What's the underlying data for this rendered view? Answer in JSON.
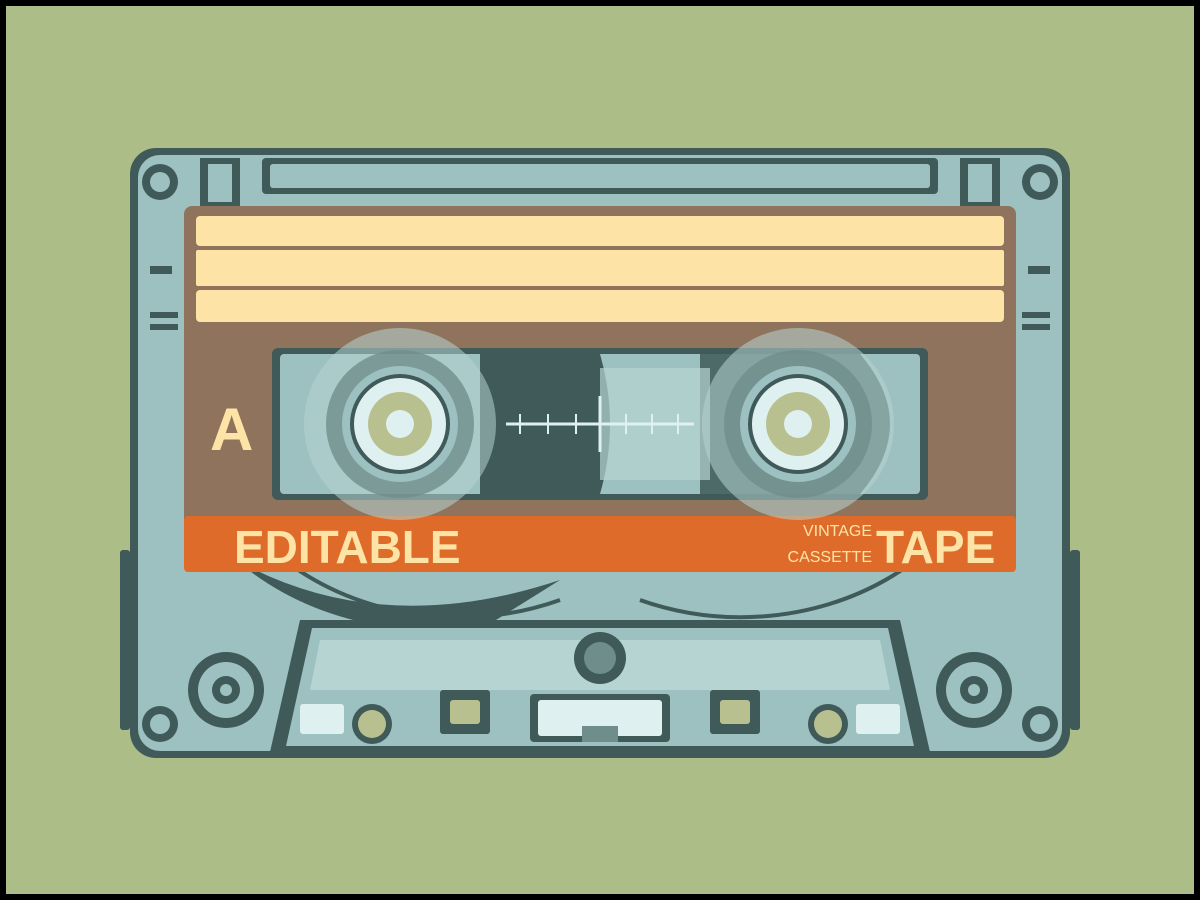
{
  "cassette": {
    "side": "A",
    "brand": "EDITABLE",
    "subtitle_line1": "VINTAGE",
    "subtitle_line2": "CASSETTE",
    "product": "TAPE"
  },
  "colors": {
    "background": "#adbd88",
    "border": "#000000",
    "shell": "#9cc1c0",
    "shell_dark": "#3f5a58",
    "label_brown": "#8f735d",
    "label_cream": "#fde4a6",
    "stripe_orange": "#de6b2a",
    "label_text": "#fde4a6",
    "reel_hub": "#b9c08f"
  }
}
